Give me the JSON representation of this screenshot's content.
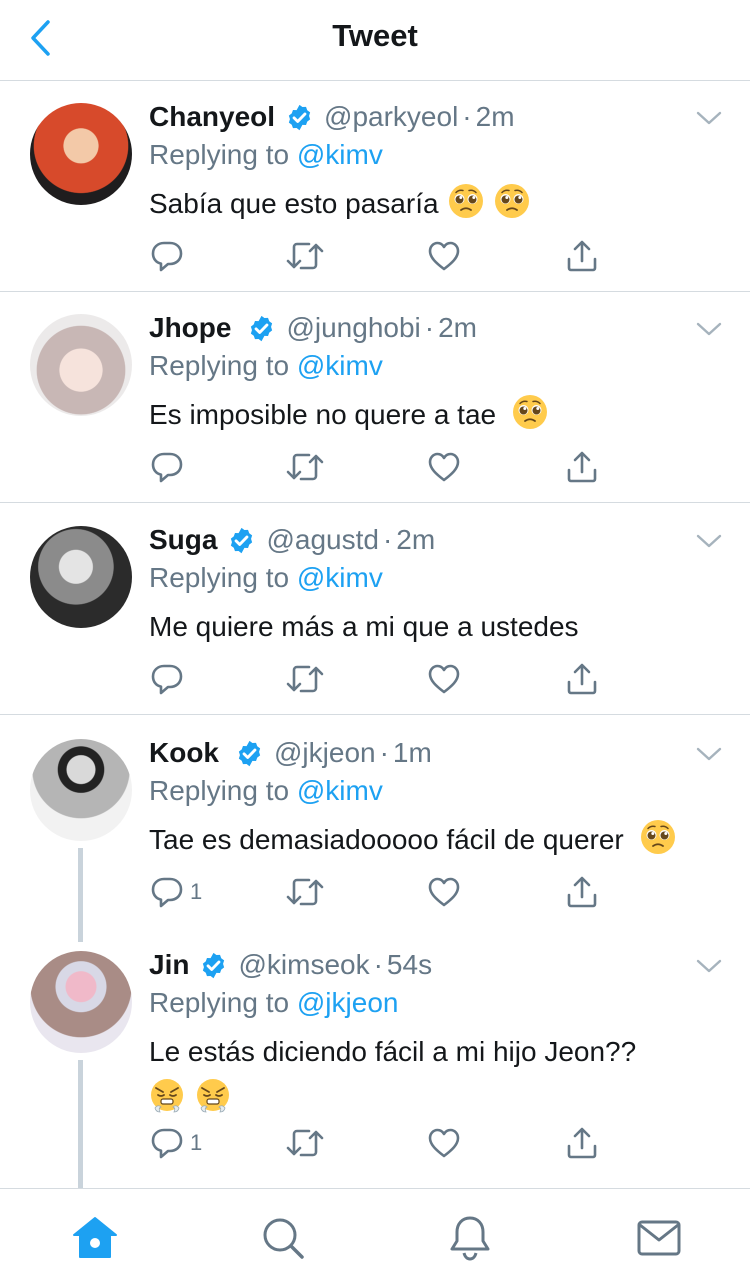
{
  "header": {
    "title": "Tweet"
  },
  "tweets": [
    {
      "name": "Chanyeol",
      "handle": "@parkyeol",
      "time": "2m",
      "replying_prefix": "Replying to",
      "replying_to": "@kimv",
      "text": "Sabía que esto pasaría",
      "emoji": "pleading-face",
      "emoji_count": 2,
      "reply_count": ""
    },
    {
      "name": "Jhope",
      "handle": "@junghobi",
      "time": "2m",
      "replying_prefix": "Replying to",
      "replying_to": "@kimv",
      "text": "Es imposible no quere a tae",
      "emoji": "pleading-face",
      "emoji_count": 1,
      "reply_count": ""
    },
    {
      "name": "Suga",
      "handle": "@agustd",
      "time": "2m",
      "replying_prefix": "Replying to",
      "replying_to": "@kimv",
      "text": "Me quiere más a mi que a ustedes",
      "emoji": "",
      "emoji_count": 0,
      "reply_count": ""
    },
    {
      "name": "Kook",
      "handle": "@jkjeon",
      "time": "1m",
      "replying_prefix": "Replying to",
      "replying_to": "@kimv",
      "text": "Tae es demasiadooooo fácil de querer",
      "emoji": "pleading-face",
      "emoji_count": 1,
      "reply_count": "1"
    },
    {
      "name": "Jin",
      "handle": "@kimseok",
      "time": "54s",
      "replying_prefix": "Replying to",
      "replying_to": "@jkjeon",
      "text": "Le estás diciendo fácil a mi hijo Jeon??",
      "emoji": "huffing-face",
      "emoji_count": 2,
      "reply_count": "1"
    }
  ],
  "icons": {
    "back": "chevron-left-icon",
    "verified": "verified-badge-icon",
    "more": "chevron-down-icon",
    "reply": "reply-icon",
    "retweet": "retweet-icon",
    "like": "heart-icon",
    "share": "share-icon",
    "tabs": [
      "home-icon",
      "search-icon",
      "notifications-icon",
      "messages-icon"
    ]
  },
  "colors": {
    "accent": "#1da1f2",
    "secondary_text": "#657786",
    "divider": "#d5dbe0",
    "thread_line": "#c9d3db"
  }
}
